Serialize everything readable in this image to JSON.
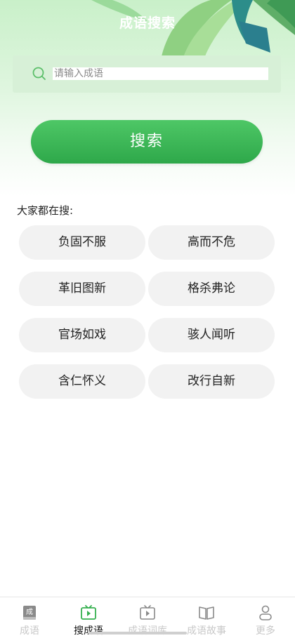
{
  "header": {
    "title": "成语搜索"
  },
  "search": {
    "placeholder": "请输入成语",
    "value": "",
    "button_label": "搜索"
  },
  "popular": {
    "label": "大家都在搜:",
    "tags": [
      "负固不服",
      "高而不危",
      "革旧图新",
      "格杀弗论",
      "官场如戏",
      "骇人闻听",
      "含仁怀义",
      "改行自新"
    ]
  },
  "tabbar": {
    "active_index": 1,
    "items": [
      {
        "label": "成语",
        "icon": "book-icon"
      },
      {
        "label": "搜成语",
        "icon": "tv-play-icon"
      },
      {
        "label": "成语词库",
        "icon": "tv-play-icon"
      },
      {
        "label": "成语故事",
        "icon": "open-book-icon"
      },
      {
        "label": "更多",
        "icon": "person-icon"
      }
    ]
  },
  "colors": {
    "accent": "#35b04f",
    "tag_bg": "#f2f2f2",
    "search_bg": "#d7f0d7"
  }
}
